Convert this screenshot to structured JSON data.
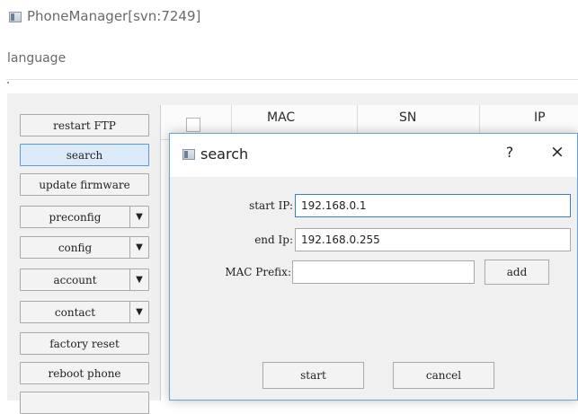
{
  "window": {
    "title": "PhoneManager[svn:7249]"
  },
  "menu": {
    "items": [
      "language"
    ]
  },
  "sidebar": {
    "buttons": [
      {
        "label": "restart FTP",
        "dropdown": false,
        "active": false
      },
      {
        "label": "search",
        "dropdown": false,
        "active": true
      },
      {
        "label": "update firmware",
        "dropdown": false,
        "active": false
      },
      {
        "label": "preconfig",
        "dropdown": true,
        "active": false
      },
      {
        "label": "config",
        "dropdown": true,
        "active": false
      },
      {
        "label": "account",
        "dropdown": true,
        "active": false
      },
      {
        "label": "contact",
        "dropdown": true,
        "active": false
      },
      {
        "label": "factory reset",
        "dropdown": false,
        "active": false
      },
      {
        "label": "reboot phone",
        "dropdown": false,
        "active": false
      }
    ]
  },
  "table": {
    "columns": [
      "MAC",
      "SN",
      "IP"
    ]
  },
  "dialog": {
    "title": "search",
    "help_symbol": "?",
    "close_symbol": "×",
    "fields": {
      "start_ip": {
        "label": "start IP:",
        "value": "192.168.0.1"
      },
      "end_ip": {
        "label": "end Ip:",
        "value": "192.168.0.255"
      },
      "mac_prefix": {
        "label": "MAC Prefix:",
        "value": ""
      }
    },
    "add_label": "add",
    "start_label": "start",
    "cancel_label": "cancel"
  },
  "icons": {
    "window": "app-window-icon",
    "dialog": "dialog-window-icon",
    "dropdown_arrow": "chevron-down-icon"
  },
  "colors": {
    "active_button": "#dbeaf9",
    "focus_border": "#3c7fc4",
    "dialog_border": "#6aa1d9"
  }
}
